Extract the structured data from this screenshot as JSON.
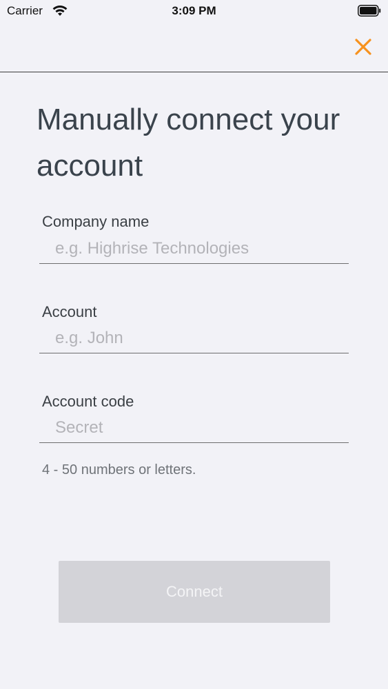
{
  "status_bar": {
    "carrier": "Carrier",
    "time": "3:09 PM"
  },
  "nav": {
    "close_icon": "close-icon",
    "accent_color": "#f7921e"
  },
  "title": "Manually connect your account",
  "form": {
    "company": {
      "label": "Company name",
      "placeholder": "e.g. Highrise Technologies"
    },
    "account": {
      "label": "Account",
      "placeholder": "e.g. John"
    },
    "code": {
      "label": "Account code",
      "placeholder": "Secret",
      "hint": "4 - 50 numbers or letters."
    }
  },
  "connect_label": "Connect"
}
